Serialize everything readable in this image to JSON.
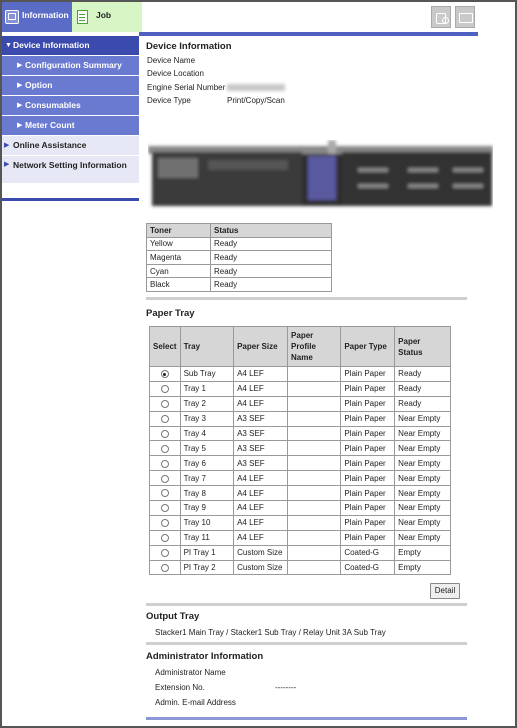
{
  "tabs": {
    "information": "Information",
    "job": "Job"
  },
  "sidebar": {
    "items": [
      {
        "label": "Device Information"
      },
      {
        "label": "Configuration Summary"
      },
      {
        "label": "Option"
      },
      {
        "label": "Consumables"
      },
      {
        "label": "Meter Count"
      },
      {
        "label": "Online Assistance"
      },
      {
        "label": "Network Setting Information"
      }
    ]
  },
  "device_info": {
    "title": "Device Information",
    "fields": [
      {
        "key": "Device Name",
        "value": ""
      },
      {
        "key": "Device Location",
        "value": ""
      },
      {
        "key": "Engine Serial Number",
        "value": ""
      },
      {
        "key": "Device Type",
        "value": "Print/Copy/Scan"
      }
    ]
  },
  "toner": {
    "headers": [
      "Toner",
      "Status"
    ],
    "rows": [
      [
        "Yellow",
        "Ready"
      ],
      [
        "Magenta",
        "Ready"
      ],
      [
        "Cyan",
        "Ready"
      ],
      [
        "Black",
        "Ready"
      ]
    ]
  },
  "paper_tray": {
    "title": "Paper Tray",
    "headers": [
      "Select",
      "Tray",
      "Paper Size",
      "Paper Profile Name",
      "Paper Type",
      "Paper Status"
    ],
    "rows": [
      {
        "selected": true,
        "tray": "Sub Tray",
        "size": "A4 LEF",
        "profile": "",
        "type": "Plain Paper",
        "status": "Ready"
      },
      {
        "selected": false,
        "tray": "Tray 1",
        "size": "A4 LEF",
        "profile": "",
        "type": "Plain Paper",
        "status": "Ready"
      },
      {
        "selected": false,
        "tray": "Tray 2",
        "size": "A4 LEF",
        "profile": "",
        "type": "Plain Paper",
        "status": "Ready"
      },
      {
        "selected": false,
        "tray": "Tray 3",
        "size": "A3 SEF",
        "profile": "",
        "type": "Plain Paper",
        "status": "Near Empty"
      },
      {
        "selected": false,
        "tray": "Tray 4",
        "size": "A3 SEF",
        "profile": "",
        "type": "Plain Paper",
        "status": "Near Empty"
      },
      {
        "selected": false,
        "tray": "Tray 5",
        "size": "A3 SEF",
        "profile": "",
        "type": "Plain Paper",
        "status": "Near Empty"
      },
      {
        "selected": false,
        "tray": "Tray 6",
        "size": "A3 SEF",
        "profile": "",
        "type": "Plain Paper",
        "status": "Near Empty"
      },
      {
        "selected": false,
        "tray": "Tray 7",
        "size": "A4 LEF",
        "profile": "",
        "type": "Plain Paper",
        "status": "Near Empty"
      },
      {
        "selected": false,
        "tray": "Tray 8",
        "size": "A4 LEF",
        "profile": "",
        "type": "Plain Paper",
        "status": "Near Empty"
      },
      {
        "selected": false,
        "tray": "Tray 9",
        "size": "A4 LEF",
        "profile": "",
        "type": "Plain Paper",
        "status": "Near Empty"
      },
      {
        "selected": false,
        "tray": "Tray 10",
        "size": "A4 LEF",
        "profile": "",
        "type": "Plain Paper",
        "status": "Near Empty"
      },
      {
        "selected": false,
        "tray": "Tray 11",
        "size": "A4 LEF",
        "profile": "",
        "type": "Plain Paper",
        "status": "Near Empty"
      },
      {
        "selected": false,
        "tray": "PI Tray 1",
        "size": "Custom Size",
        "profile": "",
        "type": "Coated-G",
        "status": "Empty"
      },
      {
        "selected": false,
        "tray": "PI Tray 2",
        "size": "Custom Size",
        "profile": "",
        "type": "Coated-G",
        "status": "Empty"
      }
    ],
    "detail_button": "Detail"
  },
  "output_tray": {
    "title": "Output Tray",
    "value": "Stacker1 Main Tray / Stacker1 Sub Tray / Relay Unit 3A Sub Tray"
  },
  "admin": {
    "title": "Administrator Information",
    "fields": [
      {
        "key": "Administrator Name",
        "value": ""
      },
      {
        "key": "Extension No.",
        "value": "--------"
      },
      {
        "key": "Admin. E-mail Address",
        "value": ""
      }
    ]
  },
  "colors": {
    "nav_dark": "#3b4aad",
    "nav_sub": "#6a7ad0",
    "nav_light": "#e6e8f6",
    "tab_info": "#5b6cc7",
    "tab_job": "#d8f5c6"
  }
}
